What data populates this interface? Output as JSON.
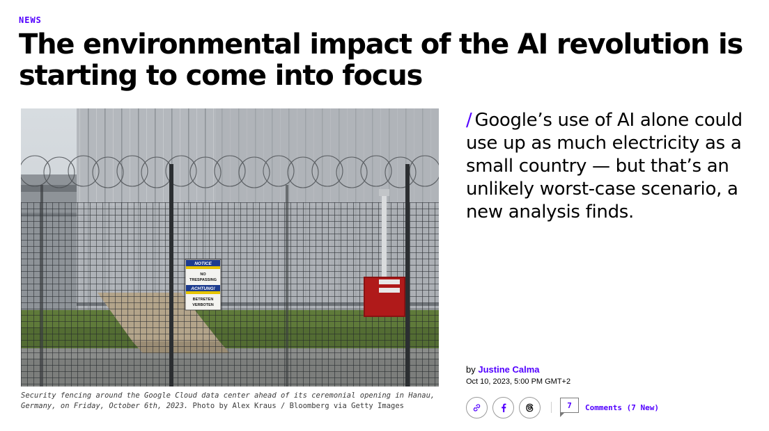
{
  "article": {
    "category": "NEWS",
    "headline": "The environmental impact of the AI revolution is starting to come into focus",
    "dek": "Google’s use of AI alone could use up as much electricity as a small country — but that’s an unlikely worst-case scenario, a new analysis finds.",
    "dek_marker": "/",
    "byline": {
      "prefix": "by",
      "author": "Justine Calma"
    },
    "date": "Oct 10, 2023, 5:00 PM GMT+2"
  },
  "hero": {
    "caption": "Security fencing around the Google Cloud data center ahead of its ceremonial opening in Hanau, Germany, on Friday, October 6th, 2023.",
    "credit": "Photo by Alex Kraus / Bloomberg via Getty Images",
    "sign": {
      "line1": "NOTICE",
      "line2": "NO",
      "line3": "TRESPASSING",
      "line4": "ACHTUNG!",
      "line5": "BETRETEN",
      "line6": "VERBOTEN"
    }
  },
  "share": {
    "icons": [
      "link-icon",
      "facebook-icon",
      "threads-icon"
    ]
  },
  "comments": {
    "count": "7",
    "label": "Comments (7 New)"
  },
  "colors": {
    "accent": "#5200ff",
    "text": "#000000"
  }
}
